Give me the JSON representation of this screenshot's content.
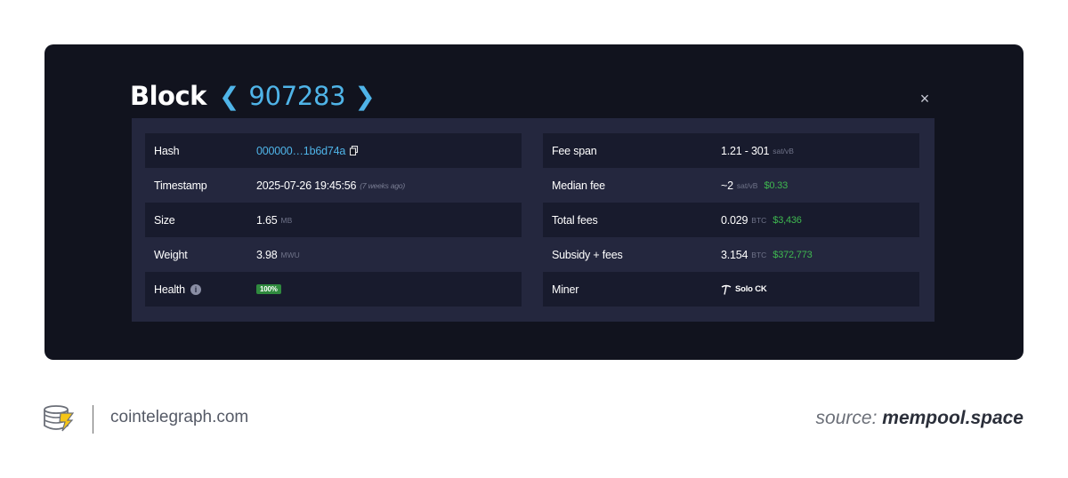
{
  "header": {
    "title_word": "Block",
    "block_number": "907283",
    "prev_icon": "chevron-left",
    "next_icon": "chevron-right",
    "close_label": "×"
  },
  "left_rows": [
    {
      "label": "Hash",
      "value": "000000…1b6d74a"
    },
    {
      "label": "Timestamp",
      "value": "2025-07-26 19:45:56",
      "note": "(7 weeks ago)"
    },
    {
      "label": "Size",
      "value": "1.65",
      "unit": "MB"
    },
    {
      "label": "Weight",
      "value": "3.98",
      "unit": "MWU"
    },
    {
      "label": "Health",
      "value": "100%"
    }
  ],
  "right_rows": [
    {
      "label": "Fee span",
      "value": "1.21 - 301",
      "unit": "sat/vB"
    },
    {
      "label": "Median fee",
      "value": "~2",
      "unit": "sat/vB",
      "usd": "$0.33"
    },
    {
      "label": "Total fees",
      "value": "0.029",
      "unit": "BTC",
      "usd": "$3,436"
    },
    {
      "label": "Subsidy + fees",
      "value": "3.154",
      "unit": "BTC",
      "usd": "$372,773"
    },
    {
      "label": "Miner",
      "value": "Solo CK"
    }
  ],
  "footer": {
    "site": "cointelegraph.com",
    "source_prefix": "source:",
    "source_name": "mempool.space"
  },
  "colors": {
    "card_bg": "#11131e",
    "panel_bg": "#24273e",
    "row_stripe": "#181b2d",
    "accent_blue": "#4fb4e8",
    "usd_green": "#3fb950",
    "health_green": "#2f8a3e"
  }
}
